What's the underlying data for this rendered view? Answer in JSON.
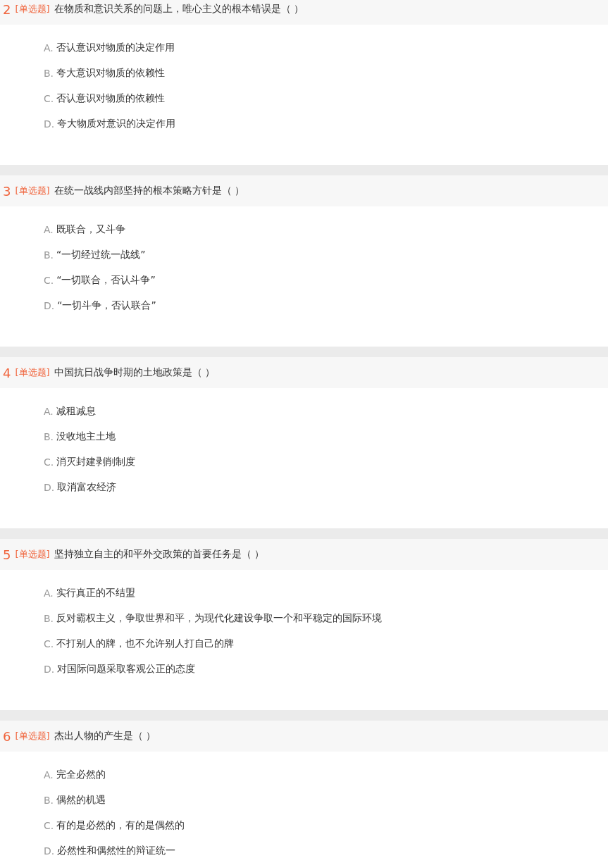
{
  "questions": [
    {
      "number": "2",
      "type": "[单选题]",
      "text": "在物质和意识关系的问题上，唯心主义的根本错误是（  ）",
      "options": [
        {
          "letter": "A.",
          "text": "否认意识对物质的决定作用"
        },
        {
          "letter": "B.",
          "text": "夸大意识对物质的依赖性"
        },
        {
          "letter": "C.",
          "text": "否认意识对物质的依赖性"
        },
        {
          "letter": "D.",
          "text": "夸大物质对意识的决定作用"
        }
      ]
    },
    {
      "number": "3",
      "type": "[单选题]",
      "text": "在统一战线内部坚持的根本策略方针是（  ）",
      "options": [
        {
          "letter": "A.",
          "text": "既联合，又斗争"
        },
        {
          "letter": "B.",
          "text": "“一切经过统一战线”"
        },
        {
          "letter": "C.",
          "text": "“一切联合，否认斗争”"
        },
        {
          "letter": "D.",
          "text": "“一切斗争，否认联合”"
        }
      ]
    },
    {
      "number": "4",
      "type": "[单选题]",
      "text": "中国抗日战争时期的土地政策是（  ）",
      "options": [
        {
          "letter": "A.",
          "text": "减租减息"
        },
        {
          "letter": "B.",
          "text": "没收地主土地"
        },
        {
          "letter": "C.",
          "text": "消灭封建剥削制度"
        },
        {
          "letter": "D.",
          "text": "取消富农经济"
        }
      ]
    },
    {
      "number": "5",
      "type": "[单选题]",
      "text": "坚持独立自主的和平外交政策的首要任务是（  ）",
      "options": [
        {
          "letter": "A.",
          "text": "实行真正的不结盟"
        },
        {
          "letter": "B.",
          "text": "反对霸权主义，争取世界和平，为现代化建设争取一个和平稳定的国际环境"
        },
        {
          "letter": "C.",
          "text": "不打别人的牌，也不允许别人打自己的牌"
        },
        {
          "letter": "D.",
          "text": "对国际问题采取客观公正的态度"
        }
      ]
    },
    {
      "number": "6",
      "type": "[单选题]",
      "text": "杰出人物的产生是（  ）",
      "options": [
        {
          "letter": "A.",
          "text": "完全必然的"
        },
        {
          "letter": "B.",
          "text": "偶然的机遇"
        },
        {
          "letter": "C.",
          "text": "有的是必然的，有的是偶然的"
        },
        {
          "letter": "D.",
          "text": "必然性和偶然性的辩证统一"
        }
      ]
    }
  ]
}
